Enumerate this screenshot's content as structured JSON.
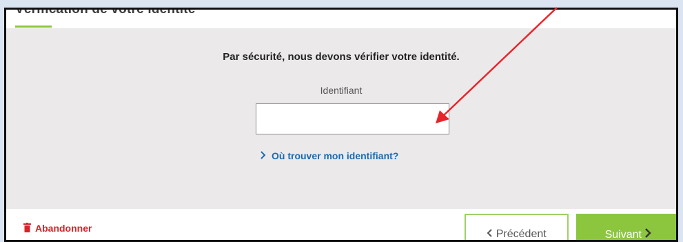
{
  "page": {
    "title": "Vérification de votre identité"
  },
  "form": {
    "headline": "Par sécurité, nous devons vérifier votre identité.",
    "identifier_label": "Identifiant",
    "identifier_value": "",
    "help_link": "Où trouver mon identifiant?"
  },
  "footer": {
    "abandon_label": "Abandonner",
    "previous_label": "Précédent",
    "next_label": "Suivant"
  },
  "colors": {
    "accent_green": "#8cc63f",
    "link_blue": "#1a6ab0",
    "danger_red": "#d8232a",
    "annotation_arrow": "#e8242b"
  },
  "icons": {
    "help_link": "chevron-right-icon",
    "abandon": "trash-icon",
    "previous": "chevron-left-icon",
    "next": "chevron-right-icon"
  }
}
